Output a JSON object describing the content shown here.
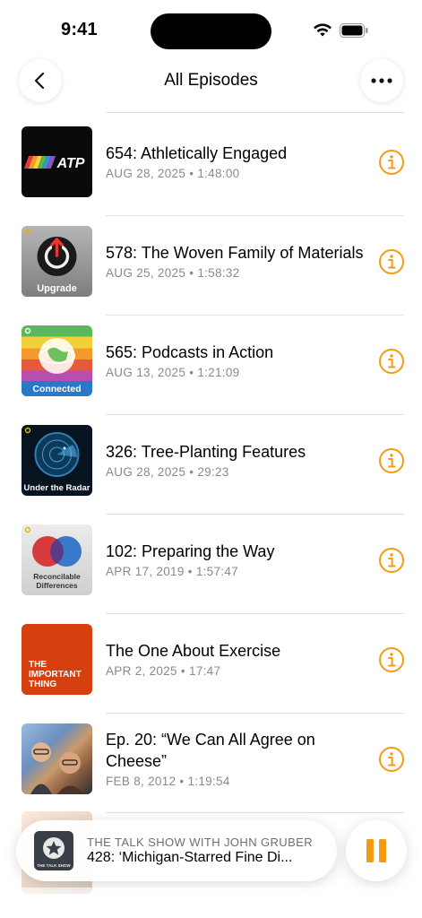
{
  "status_bar": {
    "time": "9:41"
  },
  "nav": {
    "title": "All Episodes"
  },
  "episodes": [
    {
      "title": "654: Athletically Engaged",
      "date": "AUG 28, 2025",
      "duration": "1:48:00",
      "art_label": "ATP",
      "art_bg": "#0a0a0a"
    },
    {
      "title": "578: The Woven Family of Materials",
      "date": "AUG 25, 2025",
      "duration": "1:58:32",
      "art_label": "Upgrade",
      "art_bg": "#9a9a9a"
    },
    {
      "title": "565: Podcasts in Action",
      "date": "AUG 13, 2025",
      "duration": "1:21:09",
      "art_label": "Connected",
      "art_bg": "#5aa9d6"
    },
    {
      "title": "326: Tree-Planting Features",
      "date": "AUG 28, 2025",
      "duration": "29:23",
      "art_label": "Under the Radar",
      "art_bg": "#07131f"
    },
    {
      "title": "102: Preparing the Way",
      "date": "APR 17, 2019",
      "duration": "1:57:47",
      "art_label": "Reconcilable Differences",
      "art_bg": "#d9d9d9"
    },
    {
      "title": "The One About Exercise",
      "date": "APR 2, 2025",
      "duration": "17:47",
      "art_label": "THE IMPORTANT THING",
      "art_bg": "#d6400e"
    },
    {
      "title": "Ep. 20: “We Can All Agree on Cheese”",
      "date": "FEB 8, 2012",
      "duration": "1:19:54",
      "art_label": "",
      "art_bg": "#7a9ac2"
    }
  ],
  "meta_separator": "•",
  "mini_player": {
    "show": "THE TALK SHOW WITH JOHN GRUBER",
    "title": "428: ‘Michigan-Starred Fine Di...",
    "art_label": "THE TALK SHOW"
  },
  "colors": {
    "accent": "#f39c12",
    "secondary_text": "#8a8a8e",
    "divider": "#e2e2e2"
  },
  "icons": {
    "back": "chevron-left-icon",
    "more": "ellipsis-icon",
    "info": "info-circle-icon",
    "pause": "pause-icon"
  }
}
